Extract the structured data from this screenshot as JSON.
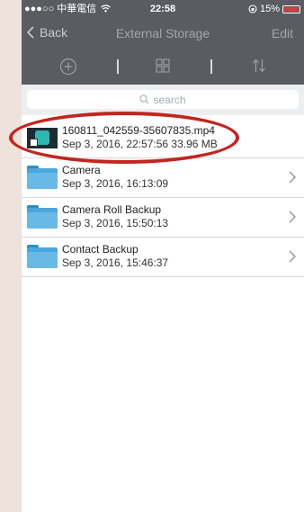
{
  "status_bar": {
    "carrier": "●●●○○ 中華電信",
    "time": "22:58",
    "battery": "15%"
  },
  "nav": {
    "back_label": "Back",
    "title": "External Storage",
    "edit_label": "Edit"
  },
  "toolbar": {
    "icons": [
      "add-icon",
      "grid-view-icon",
      "sort-icon"
    ]
  },
  "search": {
    "placeholder": "search"
  },
  "files": [
    {
      "name": "160811_042559-35607835.mp4",
      "meta": "Sep 3, 2016, 22:57:56  33.96 MB",
      "kind": "video"
    },
    {
      "name": "Camera",
      "meta": "Sep 3, 2016, 16:13:09",
      "kind": "folder"
    },
    {
      "name": "Camera Roll Backup",
      "meta": "Sep 3, 2016, 15:50:13",
      "kind": "folder"
    },
    {
      "name": "Contact Backup",
      "meta": "Sep 3, 2016, 15:46:37",
      "kind": "folder"
    }
  ],
  "colors": {
    "header": "#5a5c61",
    "annotation": "#c3251f",
    "folder": "#4aa6db",
    "battery_low": "#e0393e"
  }
}
